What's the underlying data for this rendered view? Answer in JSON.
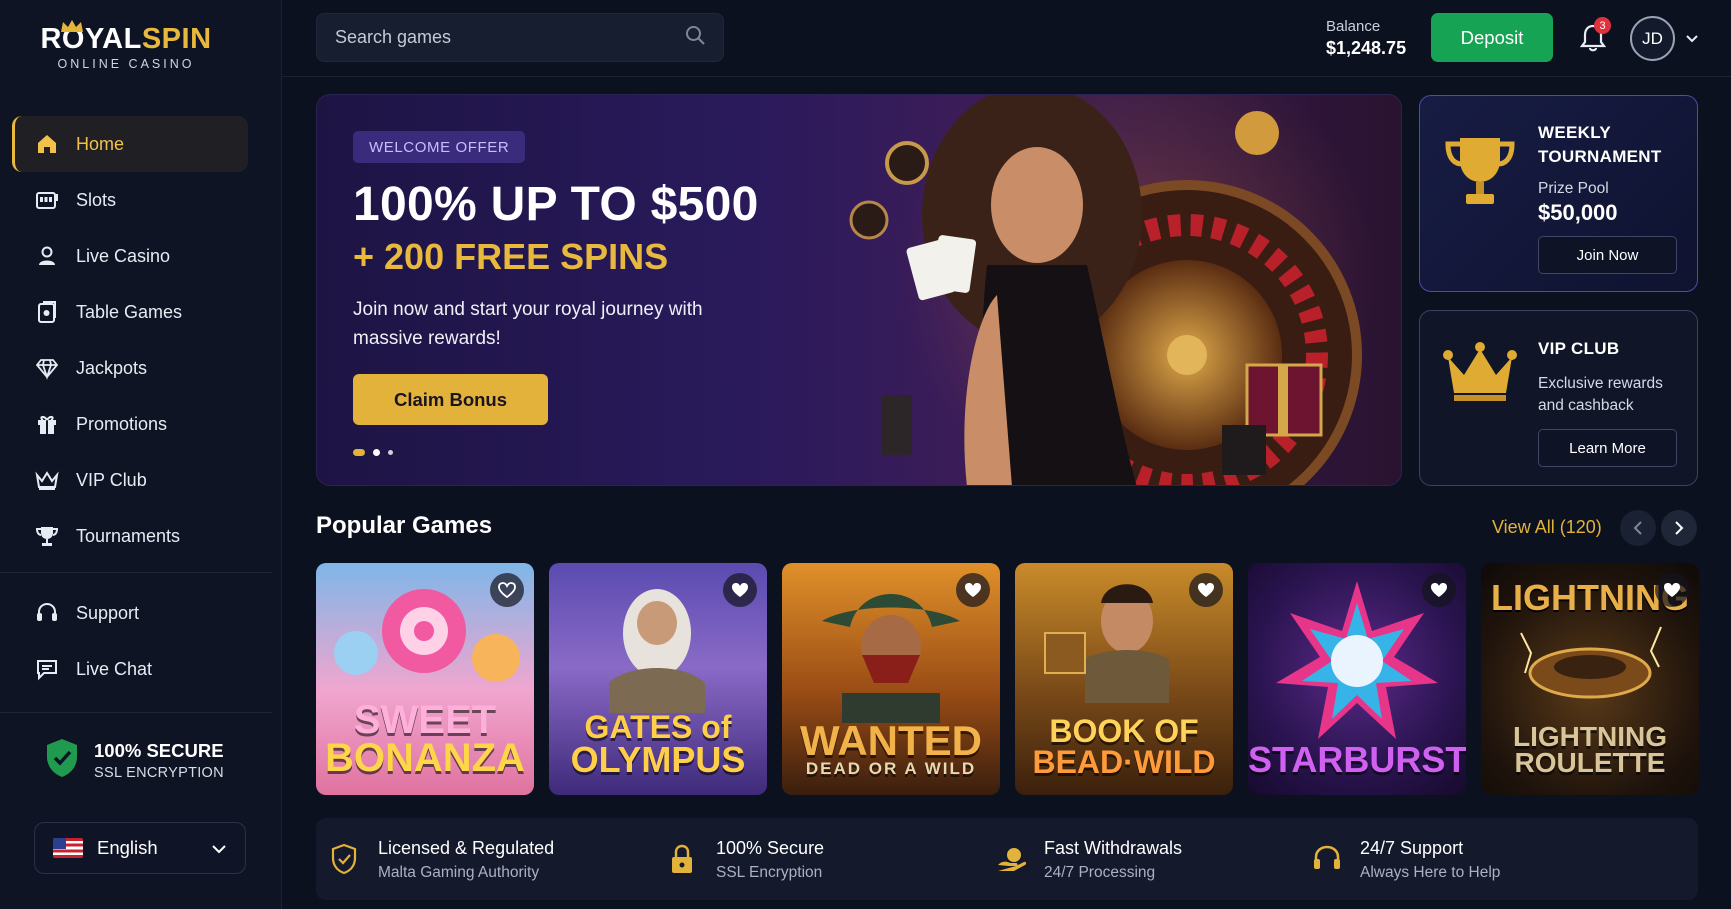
{
  "brand": {
    "name_part1": "ROYAL",
    "name_part2": "SPIN",
    "tagline": "ONLINE CASINO"
  },
  "sidebar": {
    "items": [
      {
        "label": "Home",
        "icon": "home-icon",
        "active": true
      },
      {
        "label": "Slots",
        "icon": "slot-machine-icon"
      },
      {
        "label": "Live Casino",
        "icon": "dealer-icon"
      },
      {
        "label": "Table Games",
        "icon": "cards-icon"
      },
      {
        "label": "Jackpots",
        "icon": "diamond-icon"
      },
      {
        "label": "Promotions",
        "icon": "gift-icon"
      },
      {
        "label": "VIP Club",
        "icon": "crown-icon"
      },
      {
        "label": "Tournaments",
        "icon": "trophy-icon"
      }
    ],
    "support_items": [
      {
        "label": "Support",
        "icon": "headset-icon"
      },
      {
        "label": "Live Chat",
        "icon": "chat-icon"
      }
    ],
    "secure": {
      "title": "100% SECURE",
      "subtitle": "SSL ENCRYPTION"
    },
    "language": {
      "value": "English",
      "flag": "us-flag-icon"
    }
  },
  "header": {
    "search_placeholder": "Search games",
    "balance_label": "Balance",
    "balance_value": "$1,248.75",
    "deposit_label": "Deposit",
    "notification_count": "3",
    "user_initials": "JD"
  },
  "hero": {
    "badge": "WELCOME OFFER",
    "headline": "100% UP TO $500",
    "subheadline": "+ 200 FREE SPINS",
    "description": "Join now and start your royal journey with massive rewards!",
    "cta": "Claim Bonus",
    "slides_total": 3,
    "active_slide": 1
  },
  "promo_cards": {
    "tournament": {
      "title": "WEEKLY TOURNAMENT",
      "sub": "Prize Pool",
      "value": "$50,000",
      "button": "Join Now"
    },
    "vip": {
      "title": "VIP CLUB",
      "sub": "Exclusive rewards and cashback",
      "button": "Learn More"
    }
  },
  "popular": {
    "title": "Popular Games",
    "view_all": "View All (120)",
    "games": [
      {
        "line1": "SWEET",
        "line2": "BONANZA"
      },
      {
        "line1": "GATES of",
        "line2": "OLYMPUS"
      },
      {
        "line1": "WANTED",
        "line2": "DEAD OR A WILD"
      },
      {
        "line1": "BOOK OF",
        "line2": "BEAD·WILD"
      },
      {
        "line1": "STARBURST",
        "line2": ""
      },
      {
        "line1": "LIGHTNING",
        "line2": "LIGHTNING ROULETTE"
      }
    ]
  },
  "trust": [
    {
      "title": "Licensed & Regulated",
      "sub": "Malta Gaming Authority",
      "icon": "shield-check-icon"
    },
    {
      "title": "100% Secure",
      "sub": "SSL Encryption",
      "icon": "lock-icon"
    },
    {
      "title": "Fast Withdrawals",
      "sub": "24/7 Processing",
      "icon": "money-hand-icon"
    },
    {
      "title": "24/7 Support",
      "sub": "Always Here to Help",
      "icon": "headset-icon"
    }
  ],
  "colors": {
    "accent": "#e3b23a",
    "deposit": "#16a354",
    "background": "#0c1120",
    "hero": "#2a1a5c"
  }
}
